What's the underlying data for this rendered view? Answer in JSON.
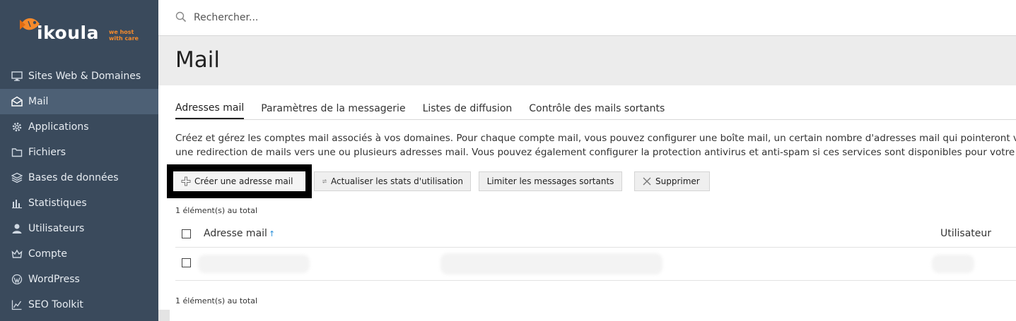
{
  "brand": {
    "name": "ikoula",
    "tagline_line1": "we host",
    "tagline_line2": "with care",
    "accent": "#f58a2b"
  },
  "sidebar": {
    "background": "#3a4a5c",
    "items": [
      {
        "label": "Sites Web & Domaines",
        "icon": "monitor-icon",
        "active": false
      },
      {
        "label": "Mail",
        "icon": "envelope-icon",
        "active": true
      },
      {
        "label": "Applications",
        "icon": "gear-icon",
        "active": false
      },
      {
        "label": "Fichiers",
        "icon": "folder-icon",
        "active": false
      },
      {
        "label": "Bases de données",
        "icon": "layers-icon",
        "active": false
      },
      {
        "label": "Statistiques",
        "icon": "bar-chart-icon",
        "active": false
      },
      {
        "label": "Utilisateurs",
        "icon": "user-icon",
        "active": false
      },
      {
        "label": "Compte",
        "icon": "crown-icon",
        "active": false
      },
      {
        "label": "WordPress",
        "icon": "wordpress-icon",
        "active": false
      },
      {
        "label": "SEO Toolkit",
        "icon": "seo-chart-icon",
        "active": false
      }
    ]
  },
  "search": {
    "placeholder": "Rechercher..."
  },
  "page": {
    "title": "Mail"
  },
  "tabs": [
    {
      "label": "Adresses mail",
      "active": true
    },
    {
      "label": "Paramètres de la messagerie",
      "active": false
    },
    {
      "label": "Listes de diffusion",
      "active": false
    },
    {
      "label": "Contrôle des mails sortants",
      "active": false
    }
  ],
  "description": {
    "line1": "Créez et gérez les comptes mail associés à vos domaines. Pour chaque compte mail, vous pouvez configurer une boîte mail, un certain nombre d'adresses mail qui pointeront vers la m",
    "line2": "une redirection de mails vers une ou plusieurs adresses mail. Vous pouvez également configurer la protection antivirus et anti-spam si ces services sont disponibles pour votre compte"
  },
  "toolbar": {
    "create_label": "Créer une adresse mail",
    "stats_label": "Actualiser les stats d'utilisation",
    "limit_label": "Limiter les messages sortants",
    "delete_label": "Supprimer"
  },
  "table": {
    "count_top": "1 élément(s) au total",
    "count_bottom": "1 élément(s) au total",
    "col_email": "Adresse mail",
    "col_email_sort": "↑",
    "col_user": "Utilisateur"
  }
}
